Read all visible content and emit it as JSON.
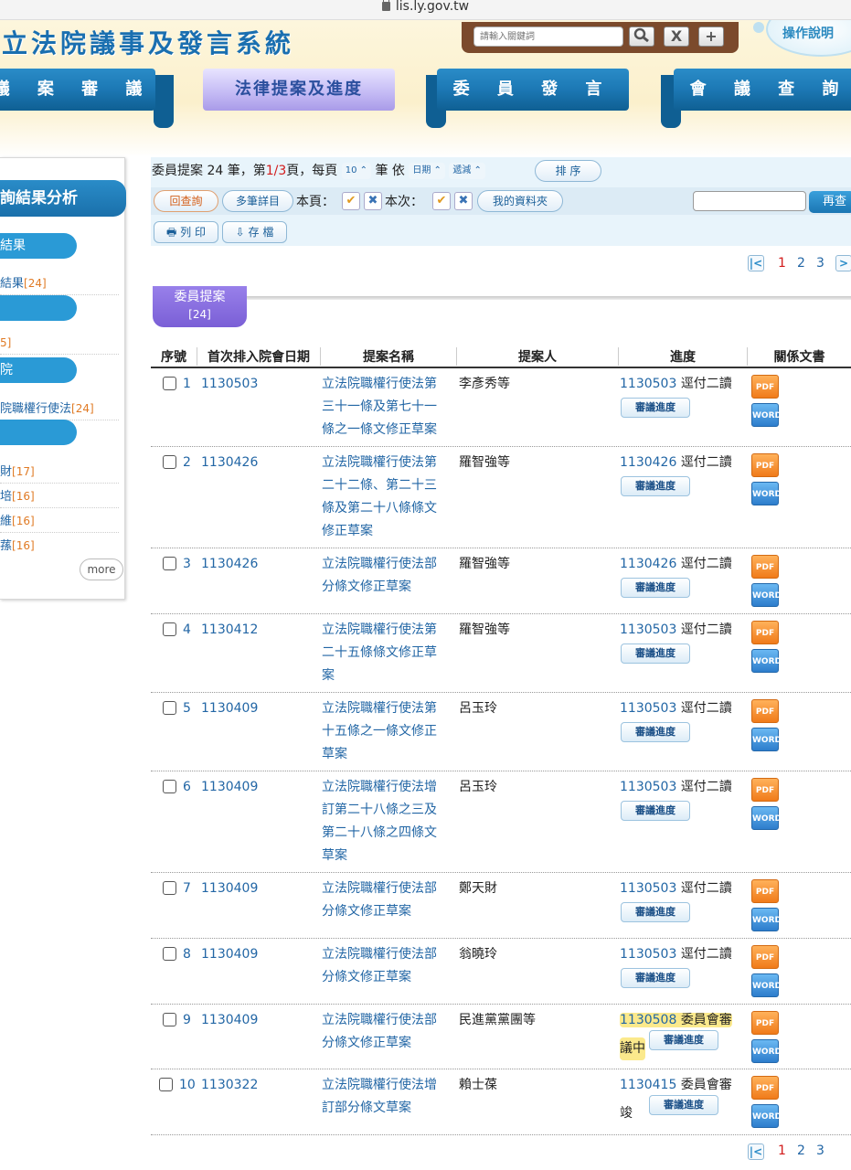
{
  "browser": {
    "url": "lis.ly.gov.tw"
  },
  "header": {
    "site_title": "立法院議事及發言系統",
    "search_placeholder": "請輸入關鍵詞",
    "search_btn": "search",
    "clear_btn": "X",
    "add_btn": "+",
    "help": "操作說明"
  },
  "nav": {
    "items": [
      "議 案 審 議",
      "法律提案及進度",
      "委 員 發 言",
      "會 議 查 詢"
    ]
  },
  "sidebar": {
    "title": "詢結果分析",
    "pill1": "結果",
    "link1": "結果",
    "link1_count": "[24]",
    "link2": "",
    "link2_count": "[]",
    "pill3": "",
    "link3": "院職權行使法",
    "link3_count": "[24]",
    "links4": [
      {
        "label": "財",
        "count": "[17]"
      },
      {
        "label": "培",
        "count": "[16]"
      },
      {
        "label": "維",
        "count": "[16]"
      },
      {
        "label": "蓀",
        "count": "[16]"
      }
    ],
    "more": "more"
  },
  "toolbar": {
    "summary_prefix": "委員提案 24 筆，第",
    "page_cur": "1/3",
    "summary_mid": "頁，每頁",
    "per_page": "10",
    "summary_suffix": "筆 依",
    "sort_field": "日期",
    "sort_dir": "遞減",
    "sort_btn": "排 序",
    "back_btn": "回查詢",
    "multi_btn": "多筆詳目",
    "this_page": "本頁：",
    "this_time": "本次：",
    "folder_btn": "我的資料夾",
    "research_btn": "再查",
    "print_btn": "列 印",
    "save_btn": "存 檔"
  },
  "pager": {
    "pages": [
      "1",
      "2",
      "3"
    ],
    "current": "1"
  },
  "section": {
    "label": "委員提案",
    "count": "[24]"
  },
  "table": {
    "headers": [
      "序號",
      "首次排入院會日期",
      "提案名稱",
      "提案人",
      "進度",
      "關係文書"
    ],
    "progress_btn": "審議進度",
    "pdf": "PDF",
    "word": "WORD",
    "rows": [
      {
        "no": "1",
        "date": "1130503",
        "title": [
          "立法院職權行使法第",
          "三十一條及第七十一",
          "條之一條文修正草案"
        ],
        "proposer": "李彥秀等",
        "prog_date": "1130503",
        "prog_text": "逕付二讀",
        "prog_text2": ""
      },
      {
        "no": "2",
        "date": "1130426",
        "title": [
          "立法院職權行使法第",
          "二十二條、第二十三",
          "條及第二十八條條文",
          "修正草案"
        ],
        "proposer": "羅智強等",
        "prog_date": "1130426",
        "prog_text": "逕付二讀",
        "prog_text2": ""
      },
      {
        "no": "3",
        "date": "1130426",
        "title": [
          "立法院職權行使法部",
          "分條文修正草案"
        ],
        "proposer": "羅智強等",
        "prog_date": "1130426",
        "prog_text": "逕付二讀",
        "prog_text2": ""
      },
      {
        "no": "4",
        "date": "1130412",
        "title": [
          "立法院職權行使法第",
          "二十五條條文修正草",
          "案"
        ],
        "proposer": "羅智強等",
        "prog_date": "1130503",
        "prog_text": "逕付二讀",
        "prog_text2": ""
      },
      {
        "no": "5",
        "date": "1130409",
        "title": [
          "立法院職權行使法第",
          "十五條之一條文修正",
          "草案"
        ],
        "proposer": "呂玉玲",
        "prog_date": "1130503",
        "prog_text": "逕付二讀",
        "prog_text2": ""
      },
      {
        "no": "6",
        "date": "1130409",
        "title": [
          "立法院職權行使法增",
          "訂第二十八條之三及",
          "第二十八條之四條文",
          "草案"
        ],
        "proposer": "呂玉玲",
        "prog_date": "1130503",
        "prog_text": "逕付二讀",
        "prog_text2": ""
      },
      {
        "no": "7",
        "date": "1130409",
        "title": [
          "立法院職權行使法部",
          "分條文修正草案"
        ],
        "proposer": "鄭天財",
        "prog_date": "1130503",
        "prog_text": "逕付二讀",
        "prog_text2": ""
      },
      {
        "no": "8",
        "date": "1130409",
        "title": [
          "立法院職權行使法部",
          "分條文修正草案"
        ],
        "proposer": "翁曉玲",
        "prog_date": "1130503",
        "prog_text": "逕付二讀",
        "prog_text2": ""
      },
      {
        "no": "9",
        "date": "1130409",
        "title": [
          "立法院職權行使法部",
          "分條文修正草案"
        ],
        "proposer": "民進黨黨團等",
        "prog_date": "1130508",
        "prog_text": "委員會審",
        "prog_text2": "議中"
      },
      {
        "no": "10",
        "date": "1130322",
        "title": [
          "立法院職權行使法增",
          "訂部分條文草案"
        ],
        "proposer": "賴士葆",
        "prog_date": "1130415",
        "prog_text": "委員會審",
        "prog_text2": "竣"
      }
    ]
  }
}
